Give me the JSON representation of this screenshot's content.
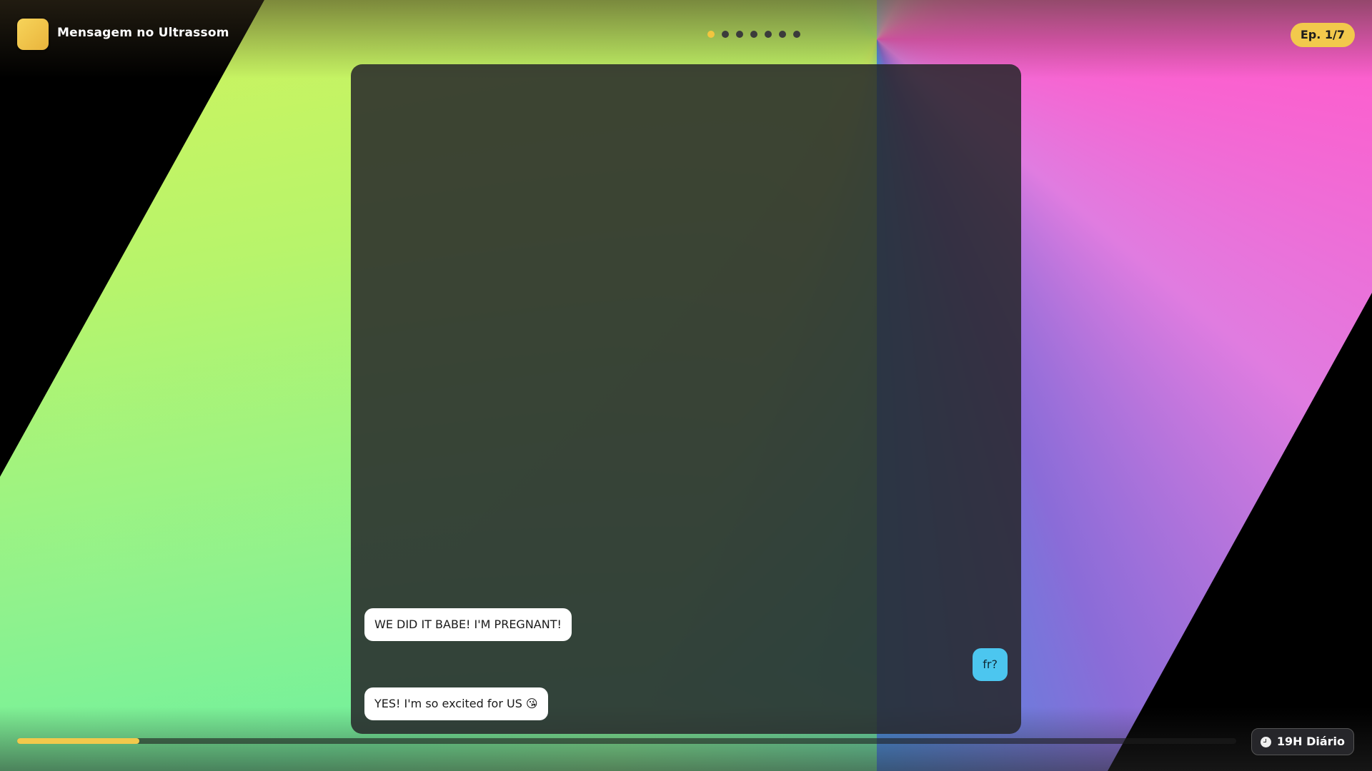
{
  "header": {
    "app_title": "Mensagem no Ultrassom",
    "episode_label": "Ep. 1/7",
    "episode_dots": {
      "total": 7,
      "active_index": 0
    }
  },
  "chat": {
    "messages": [
      {
        "side": "incoming",
        "text": "WE DID IT BABE! I'M PREGNANT!"
      },
      {
        "side": "outgoing",
        "text": "fr?"
      },
      {
        "side": "incoming",
        "text": "YES! I'm so excited for US 😘"
      }
    ]
  },
  "footer": {
    "progress_fraction": 0.1,
    "schedule_label": "19H Diário"
  },
  "colors": {
    "accent": "#f2c94c",
    "outgoing_bubble": "#4cc6ef",
    "incoming_bubble": "#ffffff",
    "panel": "#26262a"
  },
  "icons": {
    "app_logo": "app-logo-icon",
    "schedule": "clock-icon"
  }
}
